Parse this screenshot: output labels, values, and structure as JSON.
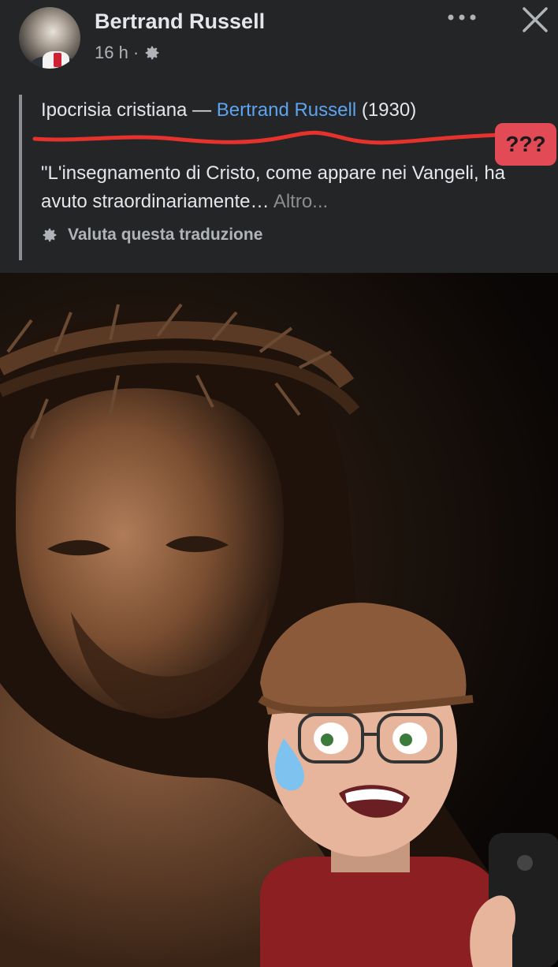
{
  "post": {
    "author": "Bertrand Russell",
    "time": "16 h",
    "separator": "·"
  },
  "quote": {
    "title_prefix": "Ipocrisia cristiana —",
    "title_link": "Bertrand Russell",
    "title_year": "(1930)",
    "text": "\"L'insegnamento di Cristo, come appare nei Vangeli, ha avuto straordinariamente…",
    "more": "Altro...",
    "rate_translation": "Valuta questa traduzione"
  },
  "annotation": {
    "badge": "???",
    "color": "#e24b55"
  },
  "icons": {
    "settings": "gear-icon",
    "more": "more-horizontal-icon",
    "close": "close-icon"
  },
  "colors": {
    "background": "#242526",
    "link": "#5ea3f0",
    "secondary_text": "#b0b3b8"
  }
}
